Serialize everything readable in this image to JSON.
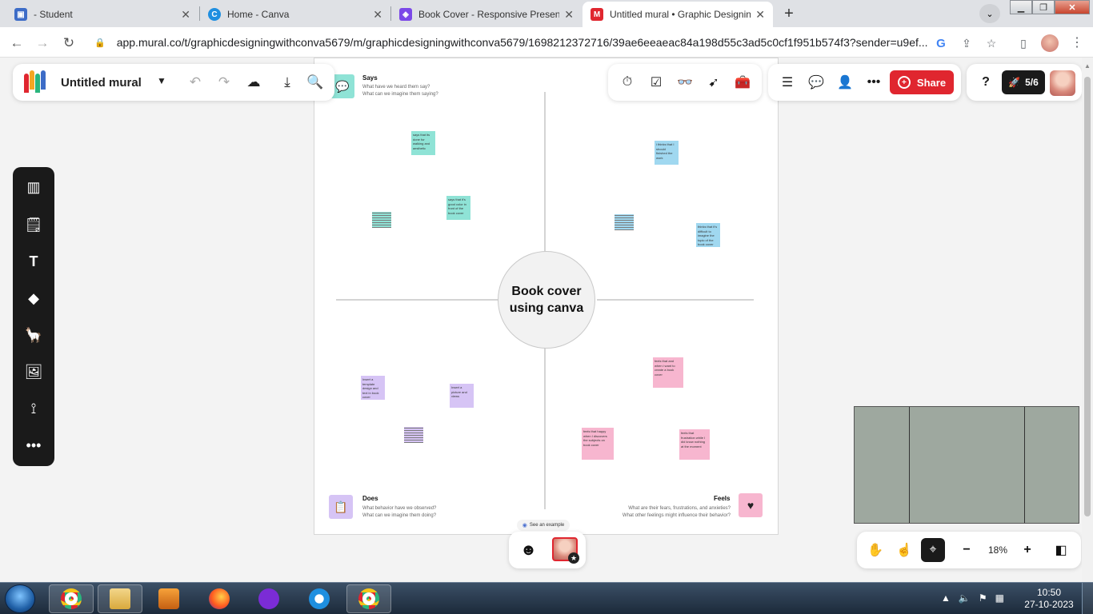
{
  "browser": {
    "tabs": [
      {
        "title": "- Student",
        "color": "#3d6cc7",
        "glyph": "▣"
      },
      {
        "title": "Home - Canva",
        "color": "#1f8fe0",
        "glyph": "C"
      },
      {
        "title": "Book Cover - Responsive Presentation",
        "color": "#7b48e8",
        "glyph": "◈"
      },
      {
        "title": "Untitled mural • Graphic Designing",
        "color": "#e0262f",
        "glyph": "M",
        "active": true
      }
    ],
    "url": "app.mural.co/t/graphicdesigningwithconva5679/m/graphicdesigningwithconva5679/1698212372716/39ae6eeaeac84a198d55c3ad5c0cf1f951b574f3?sender=u9ef..."
  },
  "mural": {
    "title": "Untitled mural",
    "share_label": "Share",
    "progress": "5/6",
    "center_text": "Book cover using canva",
    "zoom": "18%",
    "see_example": "See an example",
    "quadrants": {
      "says": {
        "title": "Says",
        "subtitle": "What have we heard them say?\nWhat can we imagine them saying?",
        "icon": "speech-bubble-icon",
        "color": "#8fe3d6"
      },
      "does": {
        "title": "Does",
        "subtitle": "What behavior have we observed?\nWhat can we imagine them doing?",
        "icon": "clipboard-icon",
        "color": "#d6c4f5"
      },
      "feels": {
        "title": "Feels",
        "subtitle": "What are their fears, frustrations, and anxieties?\nWhat other feelings might influence their behavior?",
        "icon": "heart-icon",
        "color": "#f7b6cf"
      }
    },
    "stickies": {
      "says_1": "says that its done for walking and aesthetic",
      "says_2": "says that it's good color in front of the book cover",
      "thinks_1": "i thinks that I should finished the work",
      "thinks_2": "thinks that it's difficult to imagine the topic of the book cover",
      "does_1": "Insert a template design and text in book cover",
      "does_2": "Insert a picture and views",
      "feels_1": "feels that and when i want to create a book cover",
      "feels_2": "feels that happy when I discovers the subjects on book cover",
      "feels_3": "feels that frustration while I did know nothing at the moment"
    }
  },
  "taskbar": {
    "time": "10:50",
    "date": "27-10-2023"
  }
}
